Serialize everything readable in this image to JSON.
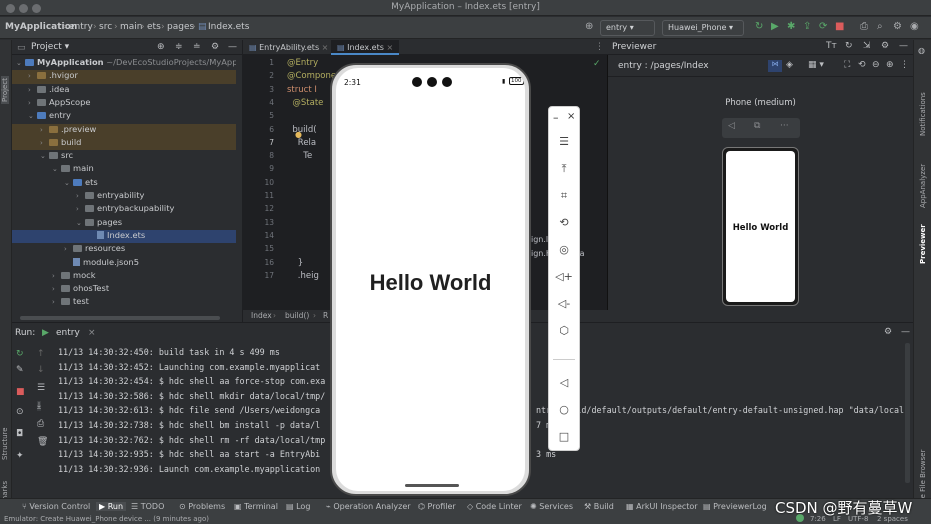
{
  "window": {
    "title": "MyApplication – Index.ets [entry]"
  },
  "breadcrumbs": [
    "MyApplication",
    "entry",
    "src",
    "main",
    "ets",
    "pages",
    "Index.ets"
  ],
  "toolbar": {
    "module_combo": "entry",
    "device_combo": "Huawei_Phone"
  },
  "project": {
    "header_label": "Project",
    "tree": [
      {
        "label": "MyApplication",
        "suffix": "~/DevEcoStudioProjects/MyApplic",
        "indent": 0,
        "type": "folder-blue",
        "open": true
      },
      {
        "label": ".hvigor",
        "indent": 1,
        "type": "folder",
        "open": false,
        "hl": true
      },
      {
        "label": ".idea",
        "indent": 1,
        "type": "folder-grey",
        "open": false
      },
      {
        "label": "AppScope",
        "indent": 1,
        "type": "folder-grey",
        "open": false
      },
      {
        "label": "entry",
        "indent": 1,
        "type": "folder-blue",
        "open": true
      },
      {
        "label": ".preview",
        "indent": 2,
        "type": "folder",
        "open": false,
        "hl": true
      },
      {
        "label": "build",
        "indent": 2,
        "type": "folder",
        "open": false,
        "hl": true
      },
      {
        "label": "src",
        "indent": 2,
        "type": "folder-grey",
        "open": true
      },
      {
        "label": "main",
        "indent": 3,
        "type": "folder-grey",
        "open": true
      },
      {
        "label": "ets",
        "indent": 4,
        "type": "folder-blue",
        "open": true
      },
      {
        "label": "entryability",
        "indent": 5,
        "type": "folder-grey",
        "open": false
      },
      {
        "label": "entrybackupability",
        "indent": 5,
        "type": "folder-grey",
        "open": false
      },
      {
        "label": "pages",
        "indent": 5,
        "type": "folder-grey",
        "open": true
      },
      {
        "label": "Index.ets",
        "indent": 6,
        "type": "file",
        "open": null,
        "sel": true
      },
      {
        "label": "resources",
        "indent": 4,
        "type": "folder-grey",
        "open": false
      },
      {
        "label": "module.json5",
        "indent": 4,
        "type": "file",
        "open": null
      },
      {
        "label": "mock",
        "indent": 3,
        "type": "folder-grey",
        "open": false
      },
      {
        "label": "ohosTest",
        "indent": 3,
        "type": "folder-grey",
        "open": false
      },
      {
        "label": "test",
        "indent": 3,
        "type": "folder-grey",
        "open": false
      }
    ]
  },
  "editor": {
    "tabs": [
      "EntryAbility.ets",
      "Index.ets"
    ],
    "code_lines": [
      {
        "ln": "1",
        "k": "an",
        "t": "@Entry"
      },
      {
        "ln": "2",
        "k": "an",
        "t": "@Componen"
      },
      {
        "ln": "3",
        "k": "kw",
        "t": "struct I"
      },
      {
        "ln": "4",
        "k": "an",
        "t": "  @State"
      },
      {
        "ln": "5",
        "k": "",
        "t": ""
      },
      {
        "ln": "6",
        "k": "",
        "t": "  build("
      },
      {
        "ln": "7",
        "k": "",
        "t": "    Rela"
      },
      {
        "ln": "8",
        "k": "",
        "t": "      Te"
      },
      {
        "ln": "9",
        "k": "",
        "t": ""
      },
      {
        "ln": "10",
        "k": "",
        "t": ""
      },
      {
        "ln": "11",
        "k": "",
        "t": ""
      },
      {
        "ln": "12",
        "k": "",
        "t": ""
      },
      {
        "ln": "13",
        "k": "",
        "t": ""
      },
      {
        "ln": "14",
        "k": "",
        "t": ""
      },
      {
        "ln": "15",
        "k": "",
        "t": ""
      },
      {
        "ln": "16",
        "k": "",
        "t": "    }"
      },
      {
        "ln": "17",
        "k": "",
        "t": "    .heig"
      }
    ],
    "code_right": [
      "ign.localAl",
      "ign.Horizonta"
    ],
    "breadcrumb": [
      "Index",
      "build()",
      "R"
    ]
  },
  "previewer": {
    "title": "Previewer",
    "route": "entry : /pages/Index",
    "device_label": "Phone (medium)",
    "mini_text": "Hello World"
  },
  "emulator": {
    "time": "2:31",
    "battery": "100",
    "main_text": "Hello World"
  },
  "run": {
    "label": "Run:",
    "config": "entry",
    "logs": [
      "11/13 14:30:32:450: build task in 4 s 499 ms",
      "11/13 14:30:32:452: Launching com.example.myapplicat",
      "11/13 14:30:32:454: $ hdc shell aa force-stop com.exa",
      "11/13 14:30:32:586: $ hdc shell mkdir data/local/tmp/",
      "11/13 14:30:32:613: $ hdc file send /Users/weidongca",
      "11/13 14:30:32:738: $ hdc shell bm install -p data/l",
      "11/13 14:30:32:762: $ hdc shell rm -rf data/local/tmp",
      "11/13 14:30:32:935: $ hdc shell aa start -a EntryAbi",
      "11/13 14:30:32:936: Launch com.example.myapplication"
    ],
    "log_tail": [
      {
        "row": 4,
        "text": "ntry/build/default/outputs/default/entry-default-unsigned.hap \"data/local"
      },
      {
        "row": 5,
        "text": "7 ms"
      },
      {
        "row": 7,
        "text": "3 ms"
      }
    ]
  },
  "bottom_tools": [
    "Version Control",
    "Run",
    "TODO",
    "Problems",
    "Terminal",
    "Log",
    "Operation Analyzer",
    "Profiler",
    "Code Linter",
    "Services",
    "Build",
    "ArkUI Inspector",
    "PreviewerLog"
  ],
  "status": {
    "message": "Emulator: Create Huawei_Phone device ... (9 minutes ago)",
    "position": "7:26",
    "line_sep": "LF",
    "encoding": "UTF-8",
    "indent": "2 spaces"
  },
  "watermark": "CSDN @野有蔓草W",
  "side_labels": {
    "left": [
      "Project",
      "Structure",
      "Bookmarks"
    ],
    "right": [
      "Notifications",
      "AppAnalyzer",
      "Previewer",
      "Device File Browser"
    ]
  }
}
